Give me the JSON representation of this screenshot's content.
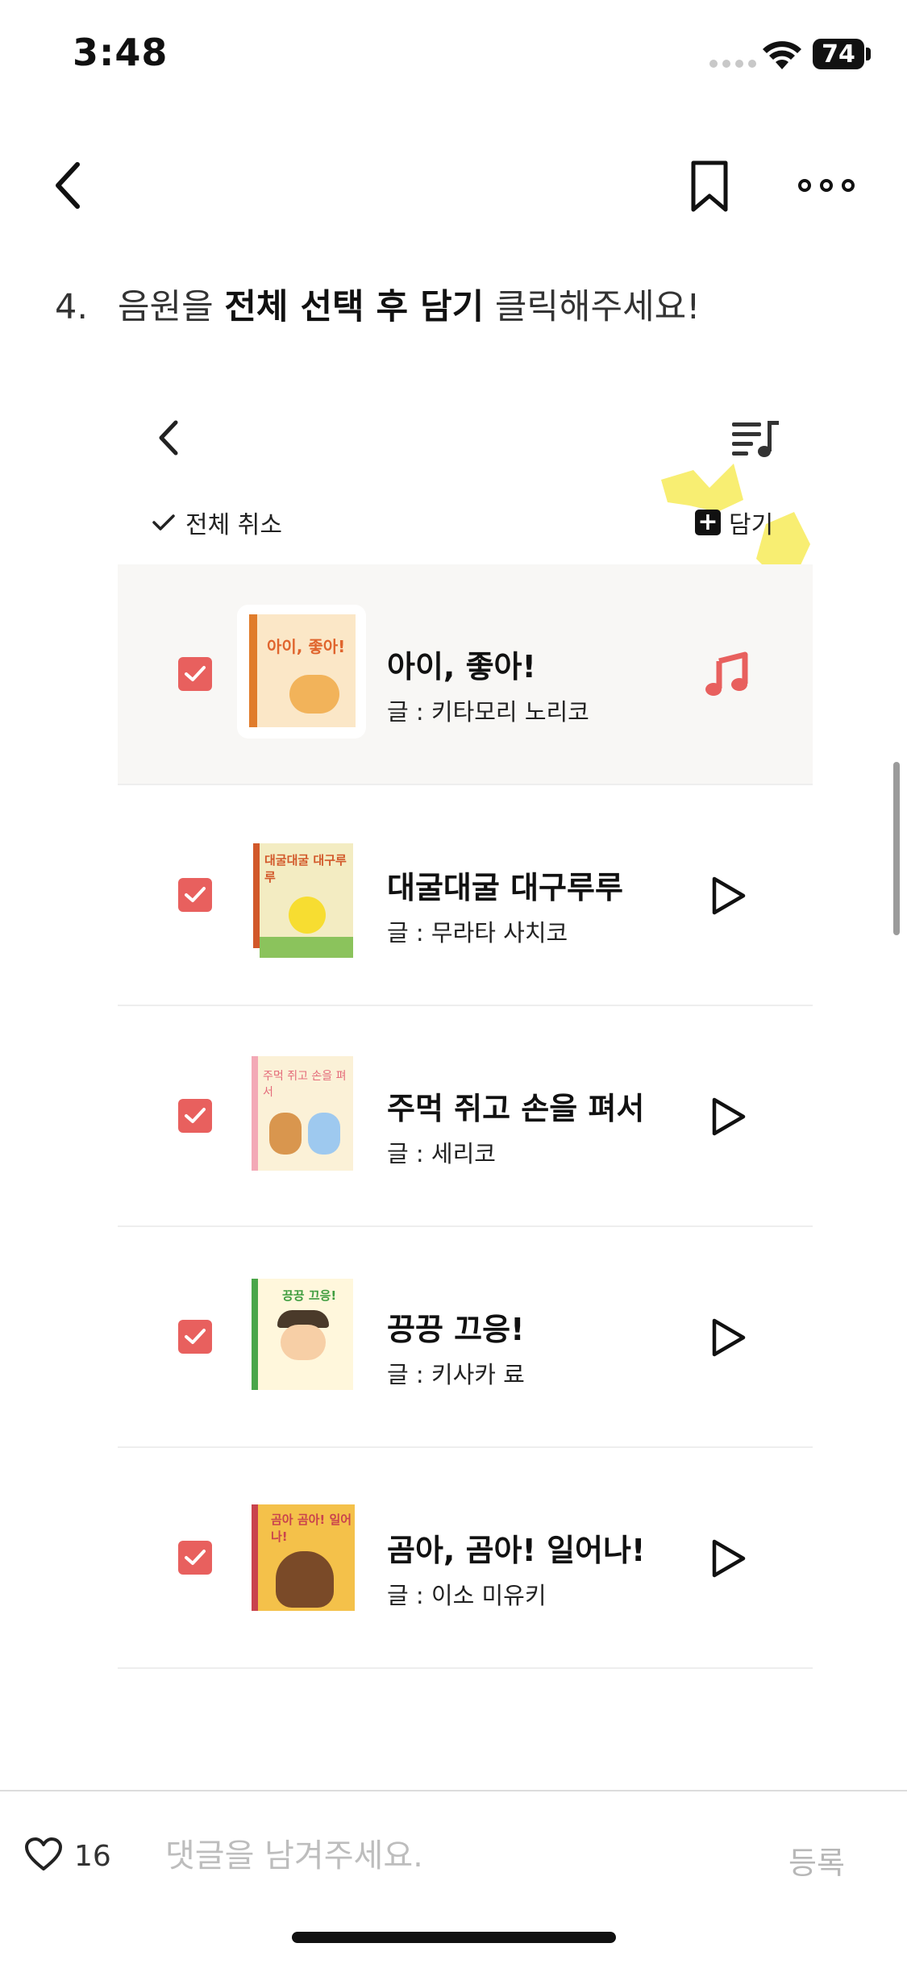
{
  "status_bar": {
    "time": "3:48",
    "battery": "74"
  },
  "nav": {
    "back_icon": "chevron-left-icon",
    "bookmark_icon": "bookmark-icon",
    "more_icon": "more-icon"
  },
  "instruction": {
    "number": "4.",
    "text_before": "음원을 ",
    "text_bold": "전체 선택 후 담기",
    "text_after": " 클릭해주세요!"
  },
  "embedded": {
    "select_all_label": "전체 취소",
    "add_label": "담기",
    "highlight_color": "#f6e94a",
    "accent_color": "#e8605e",
    "tracks": [
      {
        "title": "아이, 좋아!",
        "author": "글 : 키타모리 노리코",
        "cover_text": "아이, 좋아!",
        "checked": true,
        "status_icon": "music-note-icon",
        "active": true
      },
      {
        "title": "대굴대굴 대구루루",
        "author": "글 : 무라타 사치코",
        "cover_text": "대굴대굴 대구루루",
        "checked": true,
        "status_icon": "play-icon",
        "active": false
      },
      {
        "title": "주먹 쥐고 손을 펴서",
        "author": "글 : 세리코",
        "cover_text": "주먹 쥐고 손을 펴서",
        "checked": true,
        "status_icon": "play-icon",
        "active": false
      },
      {
        "title": "끙끙 끄응!",
        "author": "글 : 키사카 료",
        "cover_text": "끙끙 끄응!",
        "checked": true,
        "status_icon": "play-icon",
        "active": false
      },
      {
        "title": "곰아, 곰아! 일어나!",
        "author": "글 : 이소 미유키",
        "cover_text": "곰아 곰아! 일어나!",
        "checked": true,
        "status_icon": "play-icon",
        "active": false
      }
    ]
  },
  "bottom_bar": {
    "like_count": "16",
    "comment_placeholder": "댓글을 남겨주세요.",
    "submit_label": "등록"
  }
}
